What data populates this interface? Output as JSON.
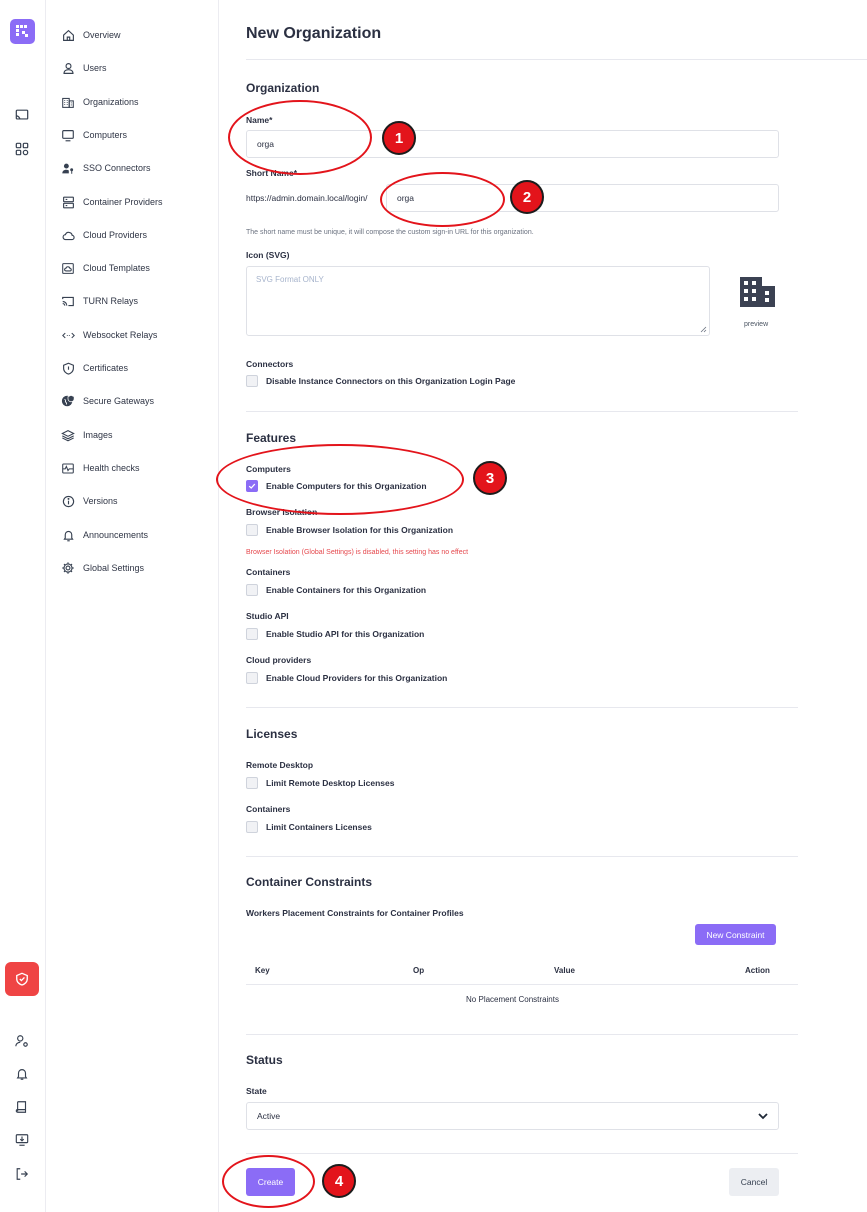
{
  "sidebar": {
    "items": [
      {
        "label": "Overview",
        "icon": "home-icon"
      },
      {
        "label": "Users",
        "icon": "user-icon"
      },
      {
        "label": "Organizations",
        "icon": "building-icon"
      },
      {
        "label": "Computers",
        "icon": "monitor-icon"
      },
      {
        "label": "SSO Connectors",
        "icon": "user-key-icon"
      },
      {
        "label": "Container Providers",
        "icon": "server-icon"
      },
      {
        "label": "Cloud Providers",
        "icon": "cloud-icon"
      },
      {
        "label": "Cloud Templates",
        "icon": "cloud-template-icon"
      },
      {
        "label": "TURN Relays",
        "icon": "cast-icon"
      },
      {
        "label": "Websocket Relays",
        "icon": "code-arrows-icon"
      },
      {
        "label": "Certificates",
        "icon": "certificate-shield-icon"
      },
      {
        "label": "Secure Gateways",
        "icon": "globe-shield-icon"
      },
      {
        "label": "Images",
        "icon": "layers-icon"
      },
      {
        "label": "Health checks",
        "icon": "heartbeat-icon"
      },
      {
        "label": "Versions",
        "icon": "info-icon"
      },
      {
        "label": "Announcements",
        "icon": "bell-icon"
      },
      {
        "label": "Global Settings",
        "icon": "gear-icon"
      }
    ]
  },
  "page": {
    "title": "New Organization"
  },
  "organization": {
    "section_title": "Organization",
    "name_label": "Name*",
    "name_value": "orga",
    "short_name_label": "Short Name*",
    "url_prefix": "https://admin.domain.local/login/",
    "short_name_value": "orga",
    "short_name_help": "The short name must be unique, it will compose the custom sign-in URL for this organization.",
    "icon_label": "Icon (SVG)",
    "icon_placeholder": "SVG Format ONLY",
    "preview_label": "preview",
    "connectors_label": "Connectors",
    "connectors_checkbox": "Disable Instance Connectors on this Organization Login Page"
  },
  "features": {
    "section_title": "Features",
    "computers_label": "Computers",
    "computers_checkbox": "Enable Computers for this Organization",
    "browser_label": "Browser Isolation",
    "browser_checkbox": "Enable Browser Isolation for this Organization",
    "browser_warning": "Browser Isolation (Global Settings) is disabled, this setting has no effect",
    "containers_label": "Containers",
    "containers_checkbox": "Enable Containers for this Organization",
    "studio_label": "Studio API",
    "studio_checkbox": "Enable Studio API for this Organization",
    "cloud_label": "Cloud providers",
    "cloud_checkbox": "Enable Cloud Providers for this Organization"
  },
  "licenses": {
    "section_title": "Licenses",
    "remote_label": "Remote Desktop",
    "remote_checkbox": "Limit Remote Desktop Licenses",
    "containers_label": "Containers",
    "containers_checkbox": "Limit Containers Licenses"
  },
  "constraints": {
    "section_title": "Container Constraints",
    "subtitle": "Workers Placement Constraints for Container Profiles",
    "new_button": "New Constraint",
    "columns": [
      "Key",
      "Op",
      "Value",
      "Action"
    ],
    "empty": "No Placement Constraints"
  },
  "status": {
    "section_title": "Status",
    "state_label": "State",
    "state_value": "Active"
  },
  "actions": {
    "create": "Create",
    "cancel": "Cancel"
  },
  "annotations": [
    "1",
    "2",
    "3",
    "4"
  ],
  "colors": {
    "accent": "#8b6cf6",
    "danger": "#ef4444",
    "annotation": "#e3141b"
  }
}
